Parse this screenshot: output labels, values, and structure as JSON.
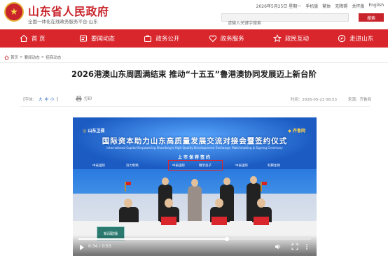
{
  "header": {
    "site_title": "山东省人民政府",
    "site_subtitle": "全国一体化在线政务服务平台·山东",
    "util_links": [
      "2026年5月25日 星期一",
      "手机版",
      "繁体",
      "无障碍",
      "关怀版",
      "English"
    ],
    "search_placeholder": "请输入关键字搜索",
    "search_button": "搜索"
  },
  "nav": {
    "items": [
      {
        "label": "首 页",
        "icon": "home-icon"
      },
      {
        "label": "要闻动态",
        "icon": "news-icon"
      },
      {
        "label": "政务公开",
        "icon": "briefcase-icon"
      },
      {
        "label": "政务服务",
        "icon": "heart-icon"
      },
      {
        "label": "政民互动",
        "icon": "star-icon"
      },
      {
        "label": "走进山东",
        "icon": "compass-icon"
      }
    ],
    "bg_color": "#d9262c"
  },
  "breadcrumb": {
    "items": [
      "首页",
      "要闻动态",
      "招商动态"
    ],
    "separator": ">"
  },
  "article": {
    "title": "2026港澳山东周圆满结束 推动“十五五”鲁港澳协同发展迈上新台阶",
    "font_size_label": "【字体：",
    "font_sizes": [
      "大",
      "中",
      "小"
    ],
    "font_size_close": "】",
    "print_label": "打印",
    "time": "时间：2026-05-23 08:53",
    "source": "来源：齐鲁网"
  },
  "video": {
    "channel_logo": "山东卫视",
    "partner_logo": "齐鲁网",
    "title": "国际资本助力山东高质量发展交流对接会暨签约仪式",
    "subtitle": "International Capital Empowering Shandong's High-Quality Development: Exchange, Matchmaking & Signing Ceremony",
    "sign_title": "上市保荐签约",
    "parties": [
      "中泰国际",
      "滨力制氧",
      "中泰国际",
      "精享良子",
      "中泰国际",
      "科腾生物"
    ],
    "current_time": "0:34",
    "duration": "0:53",
    "progress": 0.64,
    "thumbnail_text": "新闻联播"
  }
}
